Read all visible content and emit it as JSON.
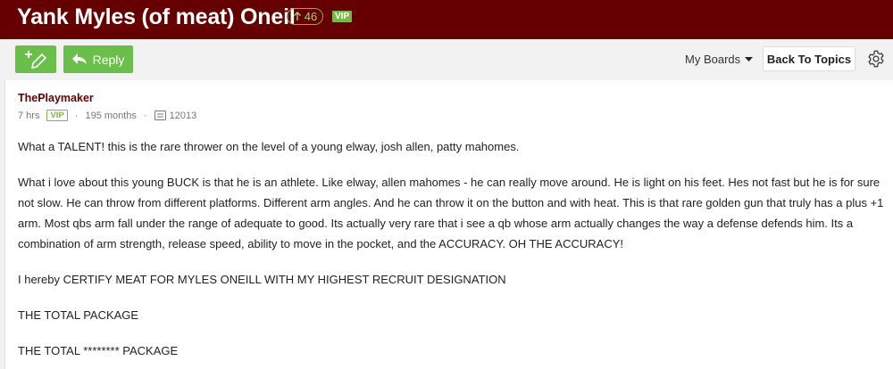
{
  "header": {
    "title": "Yank Myles (of meat) Oneil",
    "upvotes": "46",
    "vip": "VIP"
  },
  "toolbar": {
    "reply_label": "Reply",
    "my_boards_label": "My Boards",
    "back_to_topics_label": "Back To Topics"
  },
  "post": {
    "author": "ThePlaymaker",
    "time": "7 hrs",
    "vip": "VIP",
    "membership": "195 months",
    "post_count": "12013",
    "paragraphs": [
      "What a TALENT! this is the rare thrower on the level of a young elway, josh allen, patty mahomes.",
      "What i love about this young BUCK is that he is an athlete. Like elway, allen mahomes - he can really move around. He is light on his feet. Hes not fast but he is for sure not slow. He can throw from different platforms. Different arm angles. And he can throw it on the button and with heat. This is that rare golden gun that truly has a plus +1 arm. Most qbs arm fall under the range of adequate to good. Its actually very rare that i see a qb whose arm actually changes the way a defense defends him. Its a combination of arm strength, release speed, ability to move in the pocket, and the ACCURACY. OH THE ACCURACY!",
      "I hereby CERTIFY MEAT FOR MYLES ONEILL WITH MY HIGHEST RECRUIT DESIGNATION",
      "THE TOTAL PACKAGE",
      "THE TOTAL ******** PACKAGE"
    ]
  },
  "colors": {
    "header_bg": "#660000",
    "accent_green": "#6abf4b",
    "author_color": "#660000"
  }
}
